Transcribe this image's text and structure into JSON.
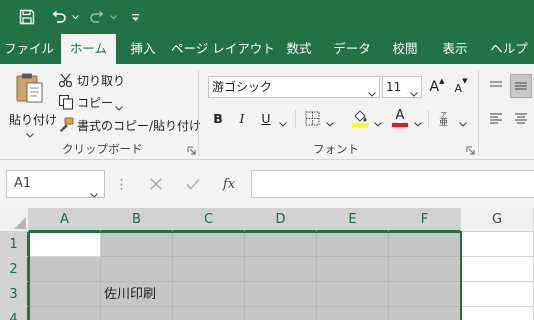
{
  "qat": {
    "save_icon": "save-icon",
    "undo_icon": "undo-icon",
    "redo_icon": "redo-icon",
    "customize_icon": "customize-qat-icon"
  },
  "tabs": [
    {
      "label": "ファイル",
      "active": false
    },
    {
      "label": "ホーム",
      "active": true
    },
    {
      "label": "挿入",
      "active": false
    },
    {
      "label": "ページ レイアウト",
      "active": false
    },
    {
      "label": "数式",
      "active": false
    },
    {
      "label": "データ",
      "active": false
    },
    {
      "label": "校閲",
      "active": false
    },
    {
      "label": "表示",
      "active": false
    },
    {
      "label": "ヘルプ",
      "active": false
    }
  ],
  "clipboard": {
    "paste": "貼り付け",
    "cut": "切り取り",
    "copy": "コピー",
    "format_painter": "書式のコピー/貼り付け",
    "group_label": "クリップボード"
  },
  "font": {
    "name": "游ゴシック",
    "size": "11",
    "grow": "A",
    "shrink": "A",
    "bold": "B",
    "italic": "I",
    "underline": "U",
    "font_color_letter": "A",
    "group_label": "フォント",
    "fill_color": "#ffff00",
    "font_color": "#e81123"
  },
  "formula_bar": {
    "name_box": "A1",
    "fx": "fx",
    "formula": ""
  },
  "grid": {
    "columns": [
      "A",
      "B",
      "C",
      "D",
      "E",
      "F",
      "G"
    ],
    "rows": [
      "1",
      "2",
      "3",
      "4"
    ],
    "cells": {
      "B3": "佐川印刷"
    }
  },
  "colors": {
    "brand": "#217346",
    "selection_fill": "#c6c6c6"
  }
}
